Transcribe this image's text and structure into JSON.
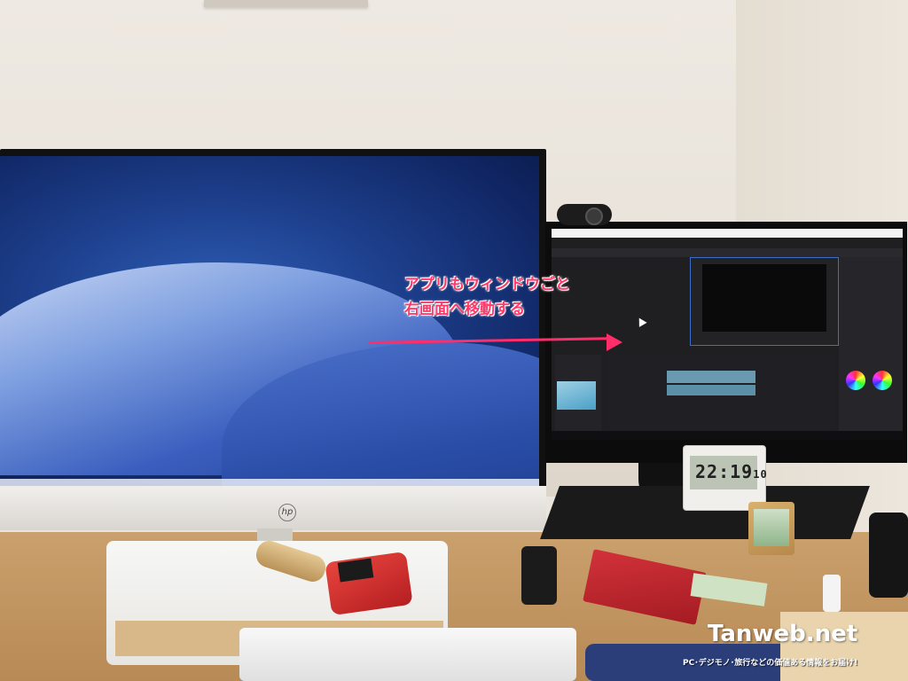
{
  "annotation": {
    "line1": "アプリもウィンドウごと",
    "line2": "右画面へ移動する",
    "color": "#ff2d6a"
  },
  "clock": {
    "time": "22:19",
    "seconds": "10"
  },
  "watermark": {
    "title": "Tanweb.net",
    "subtitle": "PC･デジモノ･旅行などの価値ある情報をお届け!"
  },
  "left_monitor": {
    "brand": "hp"
  },
  "icons": [
    "webcam-icon",
    "color-wheel-icon",
    "mouse-cursor-icon"
  ]
}
